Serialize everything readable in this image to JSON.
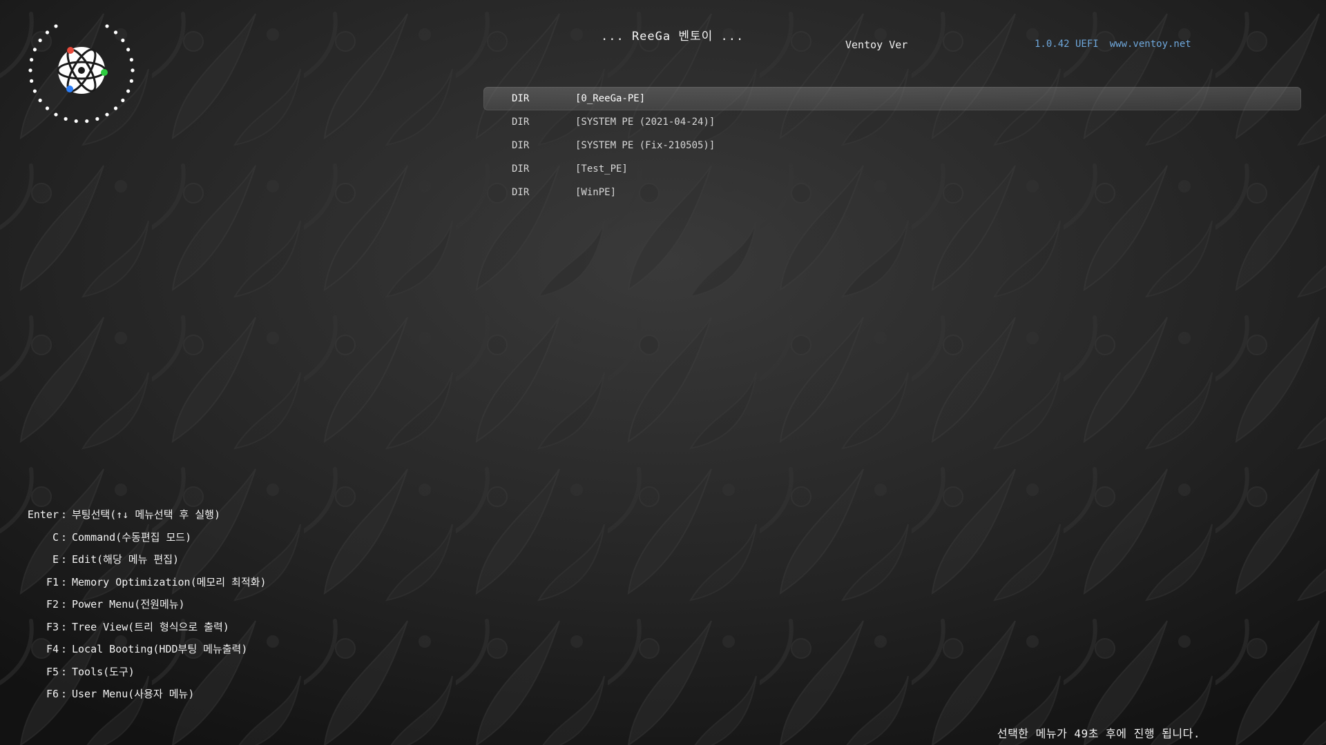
{
  "header": {
    "title": "... ReeGa 벤토이 ...",
    "version_label": "Ventoy Ver",
    "version_value": "1.0.42 UEFI",
    "website": "www.ventoy.net"
  },
  "menu": {
    "selected_index": 0,
    "items": [
      {
        "kind": "DIR",
        "name": "[0_ReeGa-PE]"
      },
      {
        "kind": "DIR",
        "name": "[SYSTEM PE (2021-04-24)]"
      },
      {
        "kind": "DIR",
        "name": "[SYSTEM PE (Fix-210505)]"
      },
      {
        "kind": "DIR",
        "name": "[Test_PE]"
      },
      {
        "kind": "DIR",
        "name": "[WinPE]"
      }
    ]
  },
  "hotkeys": [
    {
      "key": "Enter",
      "sep": ":",
      "desc": "부팅선택(↑↓ 메뉴선택 후 실행)"
    },
    {
      "key": "C",
      "sep": ":",
      "desc": "Command(수동편집 모드)"
    },
    {
      "key": "E",
      "sep": ":",
      "desc": "Edit(해당 메뉴 편집)"
    },
    {
      "key": "F1",
      "sep": ":",
      "desc": "Memory Optimization(메모리 최적화)"
    },
    {
      "key": "F2",
      "sep": ":",
      "desc": "Power Menu(전원메뉴)"
    },
    {
      "key": "F3",
      "sep": ":",
      "desc": "Tree View(트리 형식으로 출력)"
    },
    {
      "key": "F4",
      "sep": ":",
      "desc": "Local Booting(HDD부팅 메뉴출력)"
    },
    {
      "key": "F5",
      "sep": ":",
      "desc": "Tools(도구)"
    },
    {
      "key": "F6",
      "sep": ":",
      "desc": "User Menu(사용자 메뉴)"
    }
  ],
  "footer": {
    "countdown": "선택한 메뉴가 49초 후에 진행 됩니다."
  },
  "icons": {
    "logo": "atom-logo-icon"
  },
  "colors": {
    "background": "#1b1b1b",
    "text": "#f2f2f2",
    "version_accent": "#6fa8dc",
    "atom_red": "#e84b3c",
    "atom_green": "#2ecc40",
    "atom_blue": "#2d7ff9"
  }
}
